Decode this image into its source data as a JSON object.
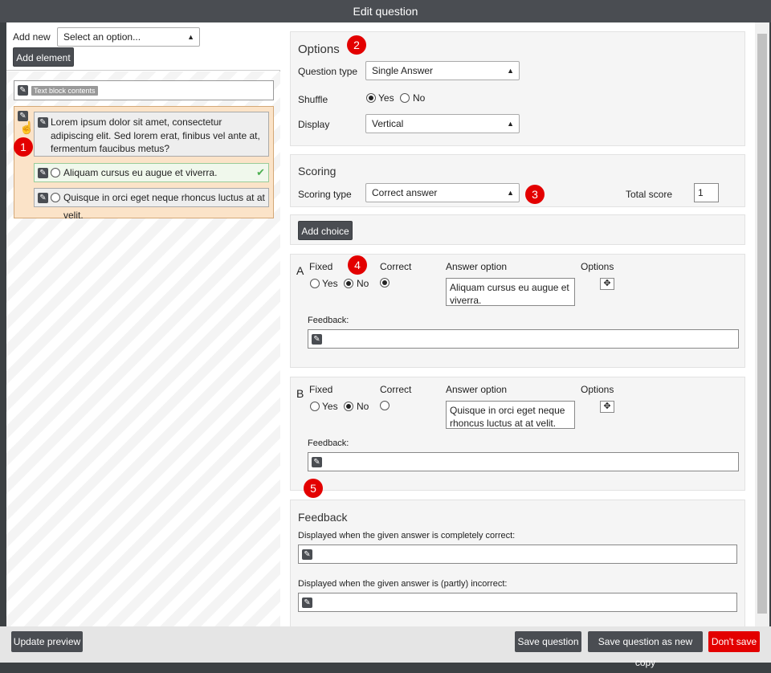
{
  "window": {
    "title": "Edit question"
  },
  "left": {
    "add_new_label": "Add new",
    "add_new_select": "Select an option...",
    "add_element": "Add element",
    "text_block_tag": "Text block contents",
    "question_text": "Lorem ipsum dolor sit amet, consectetur adipiscing elit. Sed lorem erat, finibus vel ante at, fermentum faucibus metus?",
    "answers": [
      {
        "text": "Aliquam cursus eu augue et viverra."
      },
      {
        "text": "Quisque in orci eget neque rhoncus luctus at at velit."
      }
    ]
  },
  "badges": [
    "1",
    "2",
    "3",
    "4",
    "5"
  ],
  "options": {
    "title": "Options",
    "question_type_label": "Question type",
    "question_type_value": "Single Answer",
    "shuffle_label": "Shuffle",
    "shuffle_yes": "Yes",
    "shuffle_no": "No",
    "display_label": "Display",
    "display_value": "Vertical"
  },
  "scoring": {
    "title": "Scoring",
    "scoring_type_label": "Scoring type",
    "scoring_type_value": "Correct answer",
    "total_score_label": "Total score",
    "total_score_value": "1"
  },
  "add_choice": "Add choice",
  "choices": [
    {
      "letter": "A",
      "fixed": "Fixed",
      "yes": "Yes",
      "no": "No",
      "correct": "Correct",
      "answer_option": "Answer option",
      "options": "Options",
      "answer_text": "Aliquam cursus eu augue et viverra.",
      "feedback": "Feedback:"
    },
    {
      "letter": "B",
      "fixed": "Fixed",
      "yes": "Yes",
      "no": "No",
      "correct": "Correct",
      "answer_option": "Answer option",
      "options": "Options",
      "answer_text": "Quisque in orci eget neque rhoncus luctus at at velit.",
      "feedback": "Feedback:"
    }
  ],
  "feedback": {
    "title": "Feedback",
    "correct_label": "Displayed when the given answer is completely correct:",
    "incorrect_label": "Displayed when the given answer is (partly) incorrect:"
  },
  "footer": {
    "update_preview": "Update preview",
    "save_question": "Save question",
    "save_copy": "Save question as new copy",
    "dont_save": "Don't save"
  },
  "colors": {
    "accent_red": "#e30000",
    "dark_button": "#4a4d52",
    "question_bg": "#fbe3c8"
  },
  "icons": [
    "pencil-icon",
    "checkmark-icon",
    "move-icon",
    "hand-cursor-icon",
    "chevron-updown-icon"
  ]
}
